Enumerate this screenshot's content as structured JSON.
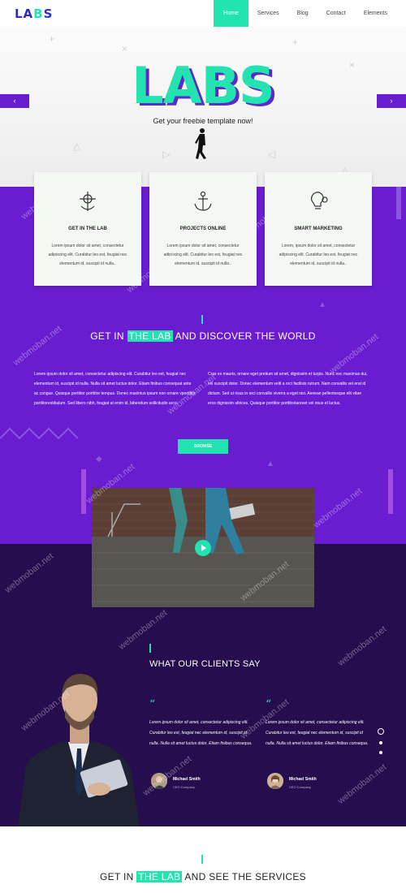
{
  "nav": {
    "logo_main": "LA",
    "logo_accent": "B",
    "logo_tail": "S",
    "items": [
      {
        "label": "Home",
        "active": true
      },
      {
        "label": "Services",
        "active": false
      },
      {
        "label": "Blog",
        "active": false
      },
      {
        "label": "Contact",
        "active": false
      },
      {
        "label": "Elements",
        "active": false
      }
    ]
  },
  "hero": {
    "title": "LABS",
    "subtitle": "Get your freebie template now!"
  },
  "features": [
    {
      "title": "GET IN THE LAB",
      "text": "Lorem ipsum dolor sit amet, consectetur adipiscing elit. Curabitur leo est, feugiat nec elementum id, suscipit id nulla..",
      "icon": "anchor-target-icon"
    },
    {
      "title": "PROJECTS ONLINE",
      "text": "Lorem ipsum dolor sit amet, consectetur adipiscing elit. Curabitur leo est, feugiat nec elementum id, suscipit id nulla..",
      "icon": "anchor-icon"
    },
    {
      "title": "SMART MARKETING",
      "text": "Lorem, ipsum dolor sit amet, consectetur adipiscing elit. Curabitur leo est, feugiat nec elementum id, suscipit id nulla..",
      "icon": "lightbulb-gear-icon"
    }
  ],
  "lab": {
    "heading_pre": "GET IN",
    "heading_hl": "THE LAB",
    "heading_post": "AND DISCOVER THE WORLD",
    "col_left": "Lorem ipsum dolor sit amet, consectetur adipiscing elit. Curabitur leo est, feugiat nec elementum id, suscipit id nulla. Nulla sit amet luctus dolor. Etiam finibus consequat ante ac congue. Quisque porttitor porttitor tempus. Donec maximus ipsum non ornare vporttitor porttitorestibulum. Sed libero nibh, feugiat at enim id, bibendum sollicitudin arcu.",
    "col_right": "Cras ex mauris, ornare eget pretium sit amet, dignissim et turpis. Nunc nec maximus dui, vel suscipit dolor. Donec elementum velit a orci facilisis rutrum. Nam convallis vel erat id dictum. Sed ut risus in orci convallis viverra a eget nisi. Aenean pellentesque elit vitae eros dignissim ultrices. Quisque porttitor porttitorlaoreet vel risus et luctus.",
    "button": "BROWSE"
  },
  "testimonials": {
    "heading": "WHAT OUR CLIENTS SAY",
    "items": [
      {
        "quote": "Lorem ipsum dolor sit amet, consectetur adipiscing elit. Curabitur leo est, feugiat nec elementum id, suscipit id nulla. Nulla sit amet luctus dolor. Etiam finibus consequa.",
        "name": "Michael Smith",
        "role": "CEO Company"
      },
      {
        "quote": "Lorem ipsum dolor sit amet, consectetur adipiscing elit. Curabitur leo est, feugiat nec elementum id, suscipit id nulla. Nulla sit amet luctus dolor. Etiam finibus consequa.",
        "name": "Michael Smith",
        "role": "CEO Company"
      }
    ]
  },
  "services": {
    "heading_pre": "GET IN",
    "heading_hl": "THE LAB",
    "heading_post": "AND SEE THE SERVICES"
  },
  "watermark": "webmoban.net",
  "colors": {
    "accent": "#23e3b0",
    "purple": "#6a1dd0",
    "dark": "#250d4e",
    "logo": "#2f2ad0"
  }
}
